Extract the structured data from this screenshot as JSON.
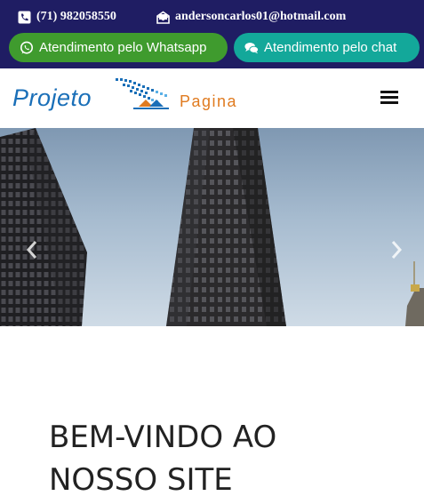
{
  "topbar": {
    "phone": "(71) 982058550",
    "email": "andersoncarlos01@hotmail.com",
    "phone_icon": "phone-square-icon",
    "email_icon": "envelope-open-icon",
    "whatsapp_button": {
      "label": "Atendimento pelo Whatsapp",
      "icon": "whatsapp-icon",
      "color": "#3f9b2e"
    },
    "chat_button": {
      "label": "Atendimento pelo chat",
      "icon": "chat-bubbles-icon",
      "color": "#13a89a"
    },
    "background": "#1f1d63"
  },
  "header": {
    "logo": {
      "word1": "Projeto",
      "word2": "Pagina",
      "word1_color": "#1a6fb8",
      "word2_color": "#e07b20"
    },
    "menu_icon": "hamburger-menu-icon"
  },
  "hero": {
    "image": "skyscrapers-photo",
    "prev_icon": "chevron-left-icon",
    "next_icon": "chevron-right-icon"
  },
  "main": {
    "welcome_title": "BEM-VINDO AO NOSSO SITE"
  }
}
